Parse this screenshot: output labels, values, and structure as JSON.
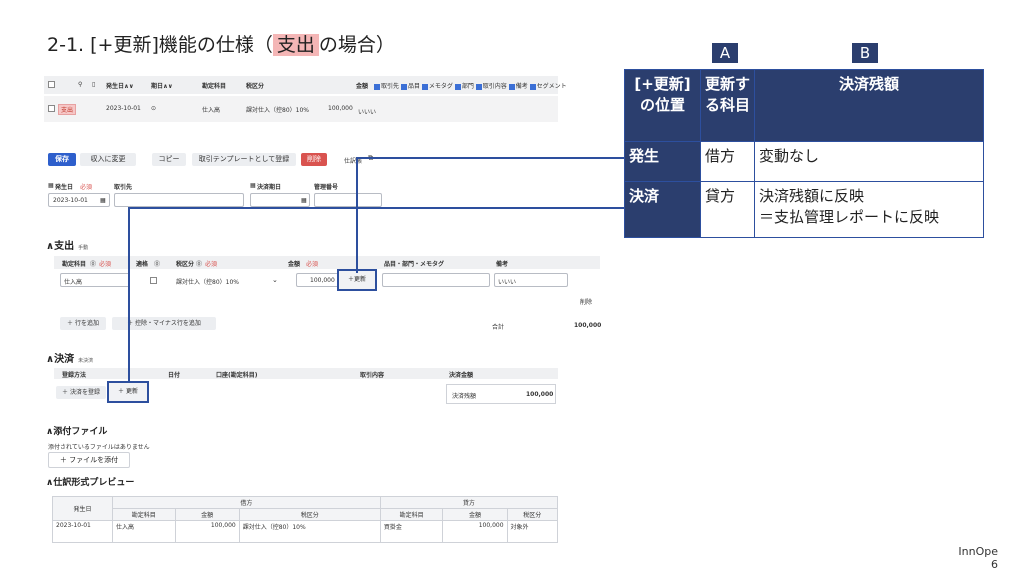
{
  "slide": {
    "title_prefix": "2-1. [+更新]機能の仕様（",
    "title_highlight": "支出",
    "title_suffix": "の場合）",
    "footer_brand": "InnOpe",
    "page_number": "6"
  },
  "list": {
    "headers": [
      "発生日∧∨",
      "期日∧∨",
      "勘定科目",
      "税区分",
      "金額"
    ],
    "header_checks": [
      "取引先",
      "品目",
      "メモタグ",
      "部門",
      "取引内容",
      "備考",
      "セグメント"
    ],
    "row": {
      "badge": "支出",
      "date": "2023-10-01",
      "account": "仕入高",
      "tax": "課対仕入（控80）10%",
      "amount": "100,000",
      "memo": "いいい"
    }
  },
  "toolbar": {
    "save": "保存",
    "to_income": "収入に変更",
    "copy": "コピー",
    "register_template": "取引テンプレートとして登録",
    "delete": "削除",
    "journal": "仕訳帳"
  },
  "form": {
    "date_label": "発生日",
    "required": "必須",
    "partner_label": "取引先",
    "due_label": "決済期日",
    "mgmt_label": "管理番号",
    "date_value": "2023-10-01"
  },
  "expense": {
    "title": "支出",
    "sub": "手動",
    "headers": {
      "account": "勘定科目",
      "proper": "適格",
      "tax": "税区分",
      "amount": "金額",
      "items": "品目・部門・メモタグ",
      "memo": "備考"
    },
    "row": {
      "account": "仕入高",
      "tax": "課対仕入（控80）10%",
      "amount": "100,000",
      "update": "＋更新",
      "memo": "いいい"
    },
    "delete": "削除",
    "add_row": "＋ 行を追加",
    "add_minus": "＋ 控除・マイナス行を追加",
    "total_label": "合計",
    "total_value": "100,000"
  },
  "settlement": {
    "title": "決済",
    "sub": "未決済",
    "headers": {
      "method": "登録方法",
      "date": "日付",
      "account": "口座(勘定科目)",
      "content": "取引内容",
      "amount": "決済金額"
    },
    "register": "＋ 決済を登録",
    "update": "＋ 更新",
    "balance_label": "決済残額",
    "balance_value": "100,000"
  },
  "attachments": {
    "title": "添付ファイル",
    "none": "添付されているファイルはありません",
    "add": "＋ ファイルを添付"
  },
  "preview": {
    "title": "仕訳形式プレビュー",
    "debit": "借方",
    "credit": "貸方",
    "date_col": "発生日",
    "cols": [
      "勘定科目",
      "金額",
      "税区分",
      "勘定科目",
      "金額",
      "税区分"
    ],
    "row": [
      "2023-10-01",
      "仕入高",
      "100,000",
      "課対仕入（控80）10%",
      "買掛金",
      "100,000",
      "対象外"
    ]
  },
  "spec": {
    "col_a": "A",
    "col_b": "B",
    "head_pos": "[+更新]の位置",
    "head_subject": "更新する科目",
    "head_balance": "決済残額",
    "rows": [
      {
        "pos": "発生",
        "subject": "借方",
        "balance": "変動なし"
      },
      {
        "pos": "決済",
        "subject": "貸方",
        "balance": "決済残額に反映",
        "balance2": "＝支払管理レポートに反映"
      }
    ]
  }
}
